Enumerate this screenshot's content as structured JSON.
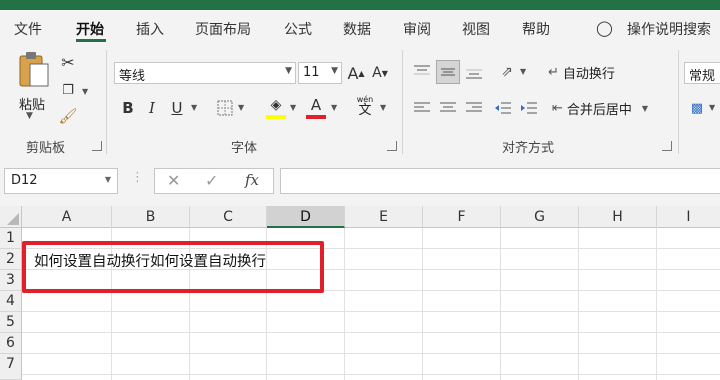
{
  "tabs": [
    "文件",
    "开始",
    "插入",
    "页面布局",
    "公式",
    "数据",
    "审阅",
    "视图",
    "帮助"
  ],
  "active_tab": "开始",
  "tell_me": "操作说明搜索",
  "ribbon": {
    "clipboard": {
      "paste_label": "粘贴",
      "group_label": "剪贴板"
    },
    "font": {
      "font_name": "等线",
      "font_size": "11",
      "phonetic_glyph": "wén",
      "phonetic_char": "文",
      "group_label": "字体",
      "fill_color": "#ffff00",
      "font_color": "#e0212b"
    },
    "alignment": {
      "wrap_text": "自动换行",
      "merge_center": "合并后居中",
      "group_label": "对齐方式"
    },
    "number": {
      "format": "常规"
    }
  },
  "formula_bar": {
    "name_box": "D12",
    "fx": "fx",
    "value": ""
  },
  "grid": {
    "columns": [
      "A",
      "B",
      "C",
      "D",
      "E",
      "F",
      "G",
      "H",
      "I"
    ],
    "selected_column": "D",
    "rows": [
      "1",
      "2",
      "3",
      "4",
      "5",
      "6",
      "7"
    ],
    "cell_a2": "如何设置自动换行如何设置自动换行"
  },
  "colors": {
    "accent": "#217346",
    "highlight_box": "#e0212b"
  }
}
